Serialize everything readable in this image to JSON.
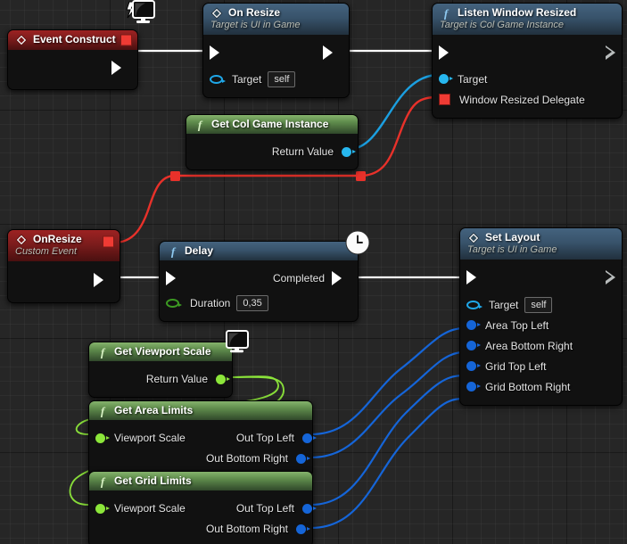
{
  "app": {
    "name": "Blueprint Event Graph",
    "background_color": "#262626"
  },
  "palette": {
    "exec_wire": "#ffffff",
    "object_wire": "#1b9fe0",
    "delegate_wire": "#e8312a",
    "vector_wire": "#1565d8",
    "float_wire": "#8ce63a",
    "event_header": "#7c1c1c",
    "function_header": "#38536b",
    "pure_header": "#5d8a4a"
  },
  "nodes": [
    {
      "id": "event-construct",
      "title": "Event Construct",
      "subtitle": "",
      "kind": "event",
      "icon": "event-diamond-icon",
      "badge": "monitor-icon",
      "has_header_delegate_pin": true,
      "outputs": [
        {
          "label": "",
          "type": "exec"
        }
      ]
    },
    {
      "id": "on-resize",
      "title": "On Resize",
      "subtitle": "Target is UI in Game",
      "kind": "interface-call",
      "icon": "event-diamond-icon",
      "inputs": [
        {
          "label": "",
          "type": "exec"
        },
        {
          "label": "Target",
          "type": "object-ref",
          "value": "self"
        }
      ],
      "outputs": [
        {
          "label": "",
          "type": "exec"
        }
      ]
    },
    {
      "id": "listen-window-resized",
      "title": "Listen Window Resized",
      "subtitle": "Target is Col Game Instance",
      "kind": "function",
      "icon": "function-f-icon",
      "inputs": [
        {
          "label": "",
          "type": "exec"
        },
        {
          "label": "Target",
          "type": "object"
        },
        {
          "label": "Window Resized Delegate",
          "type": "delegate"
        }
      ],
      "outputs": [
        {
          "label": "",
          "type": "exec-hollow"
        }
      ]
    },
    {
      "id": "get-col-game-instance",
      "title": "Get Col Game Instance",
      "subtitle": "",
      "kind": "pure",
      "icon": "function-f-icon",
      "outputs": [
        {
          "label": "Return Value",
          "type": "object"
        }
      ]
    },
    {
      "id": "on-resize-custom-event",
      "title": "OnResize",
      "subtitle": "Custom Event",
      "kind": "event",
      "icon": "event-diamond-icon",
      "has_header_delegate_pin": true,
      "outputs": [
        {
          "label": "",
          "type": "exec"
        }
      ]
    },
    {
      "id": "delay",
      "title": "Delay",
      "subtitle": "",
      "kind": "latent-function",
      "icon": "function-f-icon",
      "badge": "clock-icon",
      "inputs": [
        {
          "label": "",
          "type": "exec"
        },
        {
          "label": "Duration",
          "type": "float",
          "value": "0,35"
        }
      ],
      "outputs": [
        {
          "label": "Completed",
          "type": "exec"
        }
      ]
    },
    {
      "id": "set-layout",
      "title": "Set Layout",
      "subtitle": "Target is UI in Game",
      "kind": "interface-call",
      "icon": "event-diamond-icon",
      "inputs": [
        {
          "label": "",
          "type": "exec"
        },
        {
          "label": "Target",
          "type": "object-ref",
          "value": "self"
        },
        {
          "label": "Area Top Left",
          "type": "vector"
        },
        {
          "label": "Area Bottom Right",
          "type": "vector"
        },
        {
          "label": "Grid Top Left",
          "type": "vector"
        },
        {
          "label": "Grid Bottom Right",
          "type": "vector"
        }
      ],
      "outputs": [
        {
          "label": "",
          "type": "exec-hollow"
        }
      ]
    },
    {
      "id": "get-viewport-scale",
      "title": "Get Viewport Scale",
      "subtitle": "",
      "kind": "pure",
      "icon": "function-f-icon",
      "badge": "monitor-icon",
      "outputs": [
        {
          "label": "Return Value",
          "type": "float-full"
        }
      ]
    },
    {
      "id": "get-area-limits",
      "title": "Get Area Limits",
      "subtitle": "",
      "kind": "pure",
      "icon": "function-f-icon",
      "inputs": [
        {
          "label": "Viewport Scale",
          "type": "float-full"
        }
      ],
      "outputs": [
        {
          "label": "Out Top Left",
          "type": "vector"
        },
        {
          "label": "Out Bottom Right",
          "type": "vector"
        }
      ]
    },
    {
      "id": "get-grid-limits",
      "title": "Get Grid Limits",
      "subtitle": "",
      "kind": "pure",
      "icon": "function-f-icon",
      "inputs": [
        {
          "label": "Viewport Scale",
          "type": "float-full"
        }
      ],
      "outputs": [
        {
          "label": "Out Top Left",
          "type": "vector"
        },
        {
          "label": "Out Bottom Right",
          "type": "vector"
        }
      ]
    }
  ],
  "labels": {
    "event_construct_title": "Event Construct",
    "on_resize_title": "On Resize",
    "on_resize_sub": "Target is UI in Game",
    "listen_title": "Listen Window Resized",
    "listen_sub": "Target is Col Game Instance",
    "listen_target": "Target",
    "listen_delegate": "Window Resized Delegate",
    "gcgi_title": "Get Col Game Instance",
    "gcgi_return": "Return Value",
    "custom_title": "OnResize",
    "custom_sub": "Custom Event",
    "delay_title": "Delay",
    "delay_completed": "Completed",
    "delay_duration": "Duration",
    "delay_duration_value": "0,35",
    "setlayout_title": "Set Layout",
    "setlayout_sub": "Target is UI in Game",
    "setlayout_target": "Target",
    "setlayout_target_value": "self",
    "onresize_target": "Target",
    "onresize_target_value": "self",
    "area_top_left": "Area Top Left",
    "area_bottom_right": "Area Bottom Right",
    "grid_top_left": "Grid Top Left",
    "grid_bottom_right": "Grid Bottom Right",
    "gvs_title": "Get Viewport Scale",
    "gvs_return": "Return Value",
    "gal_title": "Get Area Limits",
    "gal_in": "Viewport Scale",
    "gal_out_tl": "Out Top Left",
    "gal_out_br": "Out Bottom Right",
    "ggl_title": "Get Grid Limits",
    "ggl_in": "Viewport Scale",
    "ggl_out_tl": "Out Top Left",
    "ggl_out_br": "Out Bottom Right"
  }
}
